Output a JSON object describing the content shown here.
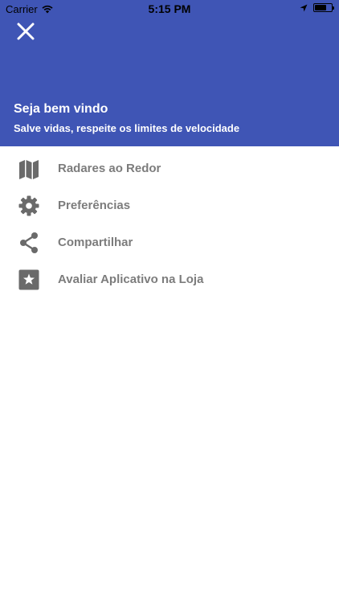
{
  "status_bar": {
    "carrier": "Carrier",
    "time": "5:15 PM",
    "battery_level": 0.7
  },
  "header": {
    "background_color": "#3f55b5",
    "title": "Seja bem vindo",
    "subtitle": "Salve vidas, respeite os limites de velocidade",
    "close_icon": "close-icon"
  },
  "menu": {
    "items": [
      {
        "label": "Radares ao Redor",
        "icon": "map-icon"
      },
      {
        "label": "Preferências",
        "icon": "gear-icon"
      },
      {
        "label": "Compartilhar",
        "icon": "share-icon"
      },
      {
        "label": "Avaliar Aplicativo na Loja",
        "icon": "star-icon"
      }
    ],
    "icon_color": "#6a6a6a",
    "label_color": "#7c7c7c"
  }
}
